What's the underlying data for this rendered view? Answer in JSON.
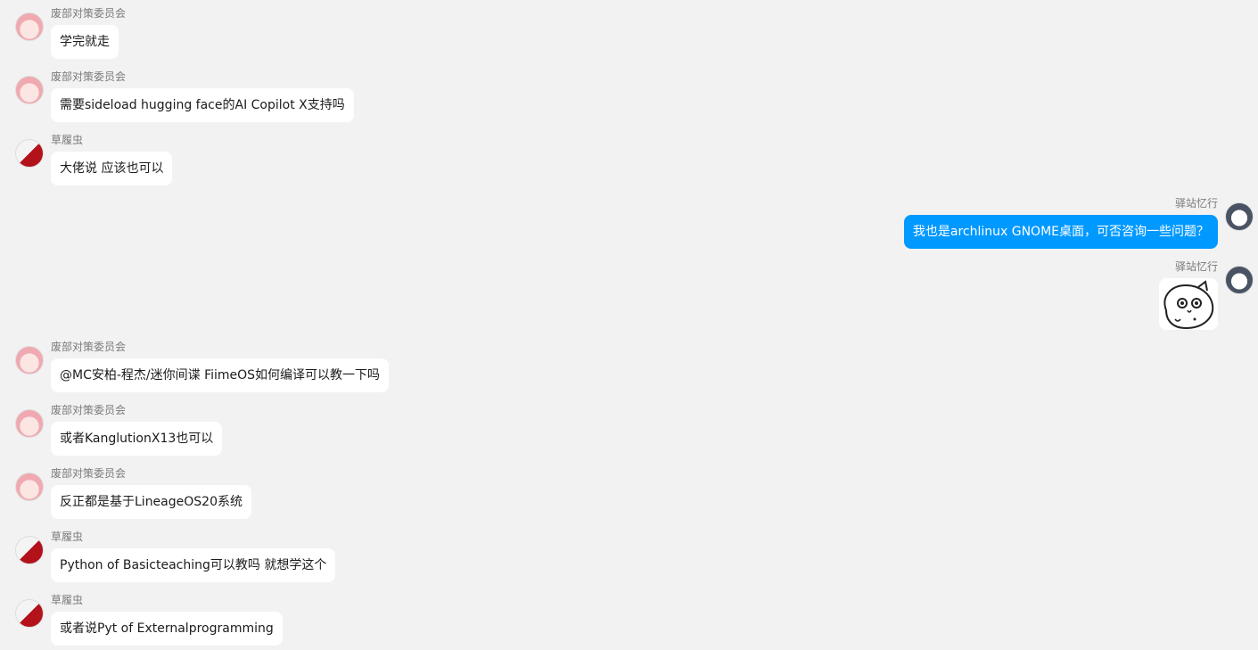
{
  "self": {
    "name": "驿站忆行",
    "bubble_color": "#0099ff"
  },
  "colors": {
    "background": "#f2f2f2",
    "incoming_bubble": "#ffffff",
    "outgoing_bubble": "#0099ff"
  },
  "messages": [
    {
      "side": "left",
      "sender": "废部对策委员会",
      "avatar": "pink-haired-avatar",
      "text": "学完就走"
    },
    {
      "side": "left",
      "sender": "废部对策委员会",
      "avatar": "pink-haired-avatar",
      "text": "需要sideload hugging face的AI Copilot X支持吗"
    },
    {
      "side": "left",
      "sender": "草履虫",
      "avatar": "red-white-avatar",
      "text": "大佬说 应该也可以"
    },
    {
      "side": "right",
      "sender": "驿站忆行",
      "avatar": "boy-avatar",
      "text": "我也是archlinux GNOME桌面，可否咨询一些问题？"
    },
    {
      "side": "right",
      "sender": "驿站忆行",
      "avatar": "boy-avatar",
      "sticker": "doodle-face-sticker"
    },
    {
      "side": "left",
      "sender": "废部对策委员会",
      "avatar": "pink-haired-avatar",
      "text": "@MC安柏-程杰/迷你间谍 FiimeOS如何编译可以教一下吗"
    },
    {
      "side": "left",
      "sender": "废部对策委员会",
      "avatar": "pink-haired-avatar",
      "text": "或者KanglutionX13也可以"
    },
    {
      "side": "left",
      "sender": "废部对策委员会",
      "avatar": "pink-haired-avatar",
      "text": "反正都是基于LineageOS20系统"
    },
    {
      "side": "left",
      "sender": "草履虫",
      "avatar": "red-white-avatar",
      "text": "Python of Basicteaching可以教吗 就想学这个"
    },
    {
      "side": "left",
      "sender": "草履虫",
      "avatar": "red-white-avatar",
      "text": "或者说Pyt of Externalprogramming"
    }
  ]
}
